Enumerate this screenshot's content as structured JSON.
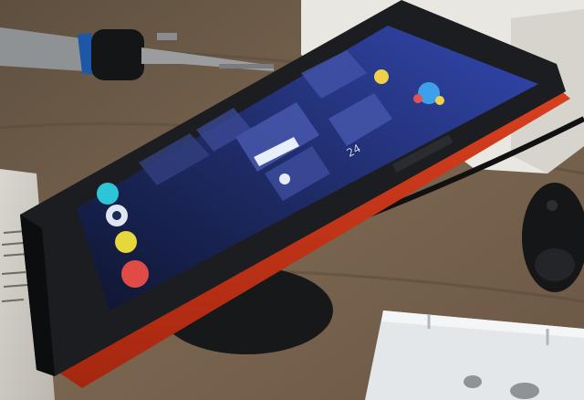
{
  "photo": {
    "subject": "jolla-phone-on-wireless-charger",
    "screen_readout": "24"
  },
  "colors": {
    "table_wood": "#6b5a48",
    "phone_body": "#1b1d20",
    "back_cover": "#c7331d",
    "screen_glow": "#2c3fa0",
    "charger_base": "#18191b",
    "white_case": "#e6e9ec"
  }
}
